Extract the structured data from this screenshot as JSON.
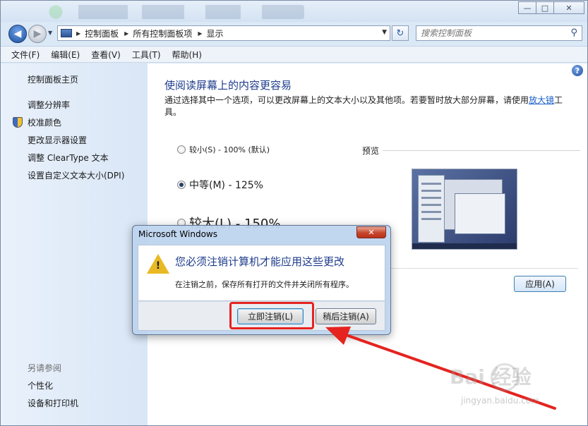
{
  "titlebar": {
    "minimize": "—",
    "maximize": "□",
    "close": "✕"
  },
  "address": {
    "crumbs": [
      "控制面板",
      "所有控制面板项",
      "显示"
    ],
    "search_placeholder": "搜索控制面板"
  },
  "menubar": [
    "文件(F)",
    "编辑(E)",
    "查看(V)",
    "工具(T)",
    "帮助(H)"
  ],
  "sidebar": {
    "items": [
      "控制面板主页",
      "调整分辨率",
      "校准颜色",
      "更改显示器设置",
      "调整 ClearType 文本",
      "设置自定义文本大小(DPI)"
    ],
    "see_also_title": "另请参阅",
    "see_also": [
      "个性化",
      "设备和打印机"
    ]
  },
  "main": {
    "heading": "使阅读屏幕上的内容更容易",
    "desc_text": "通过选择其中一个选项，可以更改屏幕上的文本大小以及其他项。若要暂时放大部分屏幕，请使用",
    "desc_link": "放大镜",
    "desc_tail": "工具。",
    "options": [
      "较小(S) - 100% (默认)",
      "中等(M) - 125%",
      "较大(L) - 150%"
    ],
    "selected_option": "中等(M) - 125%",
    "preview_label": "预览",
    "apply_button": "应用(A)"
  },
  "dialog": {
    "title": "Microsoft Windows",
    "close": "✕",
    "main_text": "您必须注销计算机才能应用这些更改",
    "sub_text": "在注销之前，保存所有打开的文件并关闭所有程序。",
    "primary_button": "立即注销(L)",
    "secondary_button": "稍后注销(A)"
  },
  "watermark": {
    "brand": "Bai 经验",
    "url": "jingyan.baidu.com"
  },
  "icons": [
    "back-arrow-icon",
    "forward-arrow-icon",
    "computer-icon",
    "refresh-icon",
    "search-icon",
    "help-icon",
    "shield-icon",
    "warning-icon"
  ],
  "colors": {
    "heading": "#1e3c8c",
    "link": "#1b5fcc",
    "annotation": "#e5231f"
  }
}
